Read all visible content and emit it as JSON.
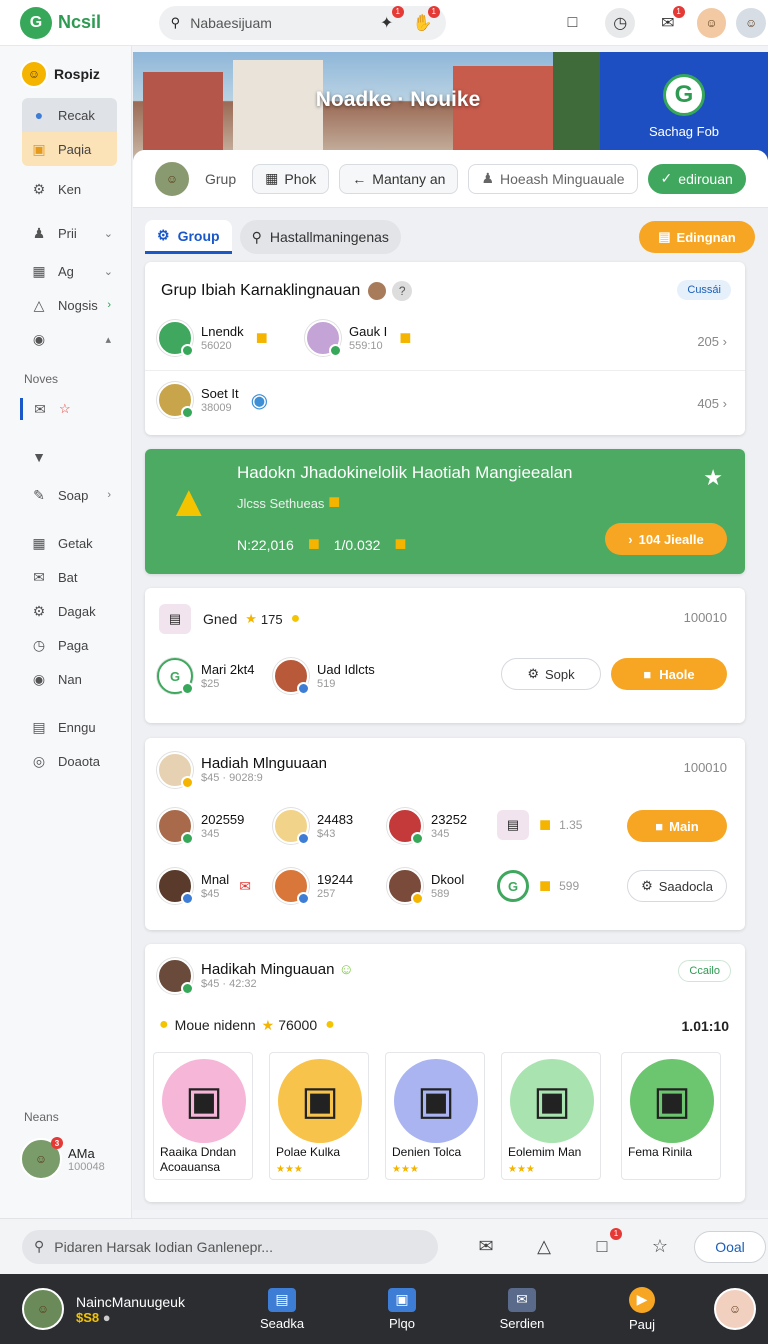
{
  "app": {
    "name": "Ncsil",
    "logo_letter": "G"
  },
  "topbar": {
    "search_placeholder": "Nabaesijuam",
    "icons": [
      "search-icon",
      "tag-icon",
      "bell-icon",
      "calendar-icon",
      "clock-icon",
      "chat-icon"
    ]
  },
  "sidebar": {
    "user": "Rospiz",
    "items": [
      {
        "label": "Recak",
        "icon": "user-icon"
      },
      {
        "label": "Paqia",
        "icon": "box-icon"
      },
      {
        "label": "Ken",
        "icon": "gear-icon"
      },
      {
        "label": "Prii",
        "icon": "people-icon"
      },
      {
        "label": "Ag",
        "icon": "calendar-icon"
      },
      {
        "label": "Nogsis",
        "icon": "bell-icon"
      }
    ],
    "section_label": "Noves",
    "section_items": [
      {
        "label": "Soap",
        "icon": "pen-icon"
      },
      {
        "label": "Getak",
        "icon": "grid-icon"
      },
      {
        "label": "Bat",
        "icon": "mail-icon"
      },
      {
        "label": "Dagak",
        "icon": "gear-icon"
      },
      {
        "label": "Paga",
        "icon": "clock-icon"
      },
      {
        "label": "Nan",
        "icon": "pin-icon"
      },
      {
        "label": "Enngu",
        "icon": "chart-icon"
      },
      {
        "label": "Doaota",
        "icon": "target-icon"
      }
    ],
    "footer_label": "Neans",
    "footer_user": {
      "name": "AMa",
      "sub": "100048",
      "notify": "3"
    }
  },
  "hero": {
    "title": "Noadke · Nouike",
    "side_label": "Sachag Fob"
  },
  "filters": {
    "group_label": "Grup",
    "chips": [
      "Phok",
      "Mantany an",
      "Hoeash Minguauale"
    ],
    "green_chip": "edirouan"
  },
  "tabs": {
    "active": "Group",
    "search": "Hastallmaningenas",
    "action": "Edingnan"
  },
  "card1": {
    "title": "Grup Ibiah Karnaklingnauan",
    "badge": "Cussái",
    "rows": [
      {
        "left": {
          "name": "Lnendk",
          "sub": "56020"
        },
        "right": {
          "name": "Gauk I",
          "sub": "559:10"
        },
        "num": "205"
      },
      {
        "left": {
          "name": "Soet It",
          "sub": "38009"
        },
        "num": "405"
      }
    ]
  },
  "card2": {
    "title": "Hadokn Jhadokinelolik Haotiah Mangieealan",
    "sub": "Jlcss Sethueas",
    "num1": "N:22,016",
    "num2": "1/0.032",
    "button": "104 Jiealle"
  },
  "card3": {
    "title": "Gned",
    "count": "175",
    "right_num": "100010",
    "person1": {
      "name": "Mari 2kt4",
      "sub": "$25"
    },
    "person2": {
      "name": "Uad Idlcts",
      "sub": "519"
    },
    "btn_outline": "Sopk",
    "btn_orange": "Haole"
  },
  "card4": {
    "title": "Hadiah Mlnguuaan",
    "sub": "$45 · 9028:9",
    "right_num": "100010",
    "row1": [
      {
        "name": "202559",
        "sub": "345"
      },
      {
        "name": "24483",
        "sub": "$43"
      },
      {
        "name": "23252",
        "sub": "345"
      }
    ],
    "row1_extra": "1.35",
    "row1_btn": "Main",
    "row2": [
      {
        "name": "Mnal",
        "sub": "$45"
      },
      {
        "name": "19244",
        "sub": "257"
      },
      {
        "name": "Dkool",
        "sub": "589"
      }
    ],
    "row2_extra": "599",
    "row2_btn": "Saadocla"
  },
  "card5": {
    "title": "Hadikah Minguauan",
    "sub": "$45 · 42:32",
    "badge": "Ccailo",
    "line_label": "Moue nidenn",
    "line_value": "76000",
    "timer": "1.01:10",
    "prizes": [
      {
        "l1": "Raaika Dndan",
        "l2": "Acoauansa",
        "color": "#f6b6d8"
      },
      {
        "l1": "Polae Kulka",
        "l2": "",
        "color": "#f8c34a"
      },
      {
        "l1": "Denien Tolca",
        "l2": "",
        "color": "#a9b4f0"
      },
      {
        "l1": "Eolemim Man",
        "l2": "",
        "color": "#a9e3b0"
      },
      {
        "l1": "Fema Rinila",
        "l2": "",
        "color": "#6cc56f"
      }
    ]
  },
  "bottom": {
    "search_placeholder": "Pidaren Harsak Iodian Ganlenepr...",
    "oval": "Ooal"
  },
  "dock": {
    "user_name": "NaincManuugeuk",
    "user_sub": "$S8",
    "items": [
      "Seadka",
      "Plqo",
      "Serdien",
      "Pauj"
    ]
  }
}
